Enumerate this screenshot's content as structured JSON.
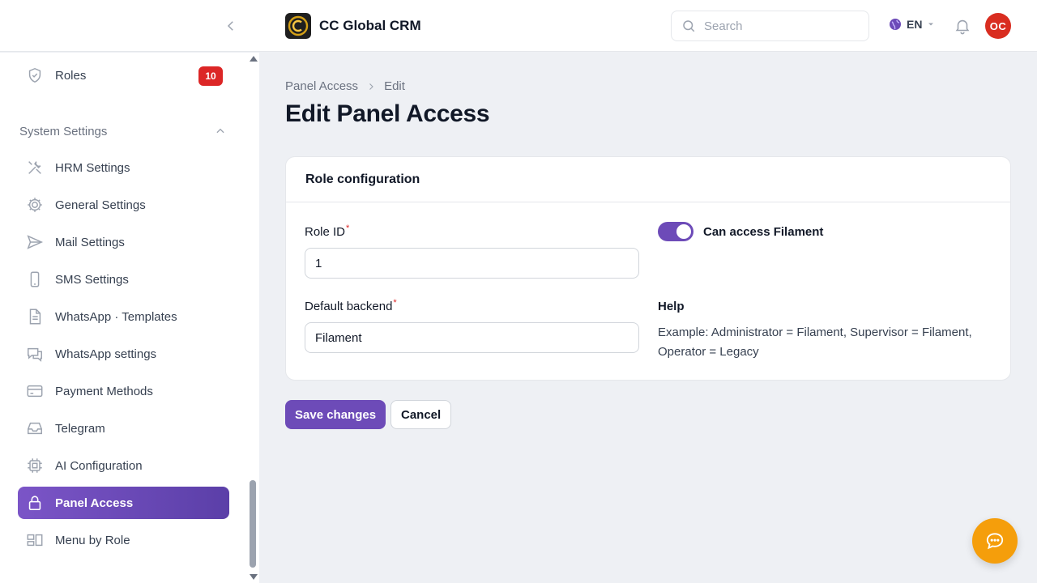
{
  "app": {
    "title": "CC Global CRM",
    "accent_color": "#6d4bb8",
    "avatar_initials": "OC",
    "language": "EN",
    "icons": {
      "collapse": "chevron-left-icon",
      "search": "search-icon",
      "language": "globe-icon",
      "notifications": "bell-icon",
      "chat": "chat-bubble-icon"
    }
  },
  "search": {
    "placeholder": "Search",
    "value": ""
  },
  "sidebar": {
    "roles": {
      "label": "Roles",
      "badge": "10",
      "icon": "shield-icon"
    },
    "group": {
      "label": "System Settings",
      "icon": "chevron-up-icon"
    },
    "items": [
      {
        "label": "HRM Settings",
        "icon": "wrench-screwdriver-icon"
      },
      {
        "label": "General Settings",
        "icon": "cog-icon"
      },
      {
        "label": "Mail Settings",
        "icon": "paper-plane-icon"
      },
      {
        "label": "SMS Settings",
        "icon": "phone-icon"
      },
      {
        "label": "WhatsApp · Templates",
        "icon": "document-icon"
      },
      {
        "label": "WhatsApp settings",
        "icon": "chat-icon"
      },
      {
        "label": "Payment Methods",
        "icon": "credit-card-icon"
      },
      {
        "label": "Telegram",
        "icon": "inbox-icon"
      },
      {
        "label": "AI Configuration",
        "icon": "cpu-chip-icon"
      },
      {
        "label": "Panel Access",
        "icon": "lock-icon",
        "active": true
      },
      {
        "label": "Menu by Role",
        "icon": "squares-icon"
      }
    ]
  },
  "breadcrumb": {
    "parent": "Panel Access",
    "current": "Edit"
  },
  "page": {
    "title": "Edit Panel Access"
  },
  "form": {
    "section_title": "Role configuration",
    "role_id": {
      "label": "Role ID",
      "required_mark": "*",
      "value": "1"
    },
    "default_backend": {
      "label": "Default backend",
      "required_mark": "*",
      "value": "Filament"
    },
    "can_access": {
      "label": "Can access Filament",
      "enabled": true
    },
    "help": {
      "label": "Help",
      "text": "Example: Administrator = Filament, Supervisor = Filament, Operator = Legacy"
    }
  },
  "actions": {
    "save_label": "Save changes",
    "cancel_label": "Cancel"
  }
}
